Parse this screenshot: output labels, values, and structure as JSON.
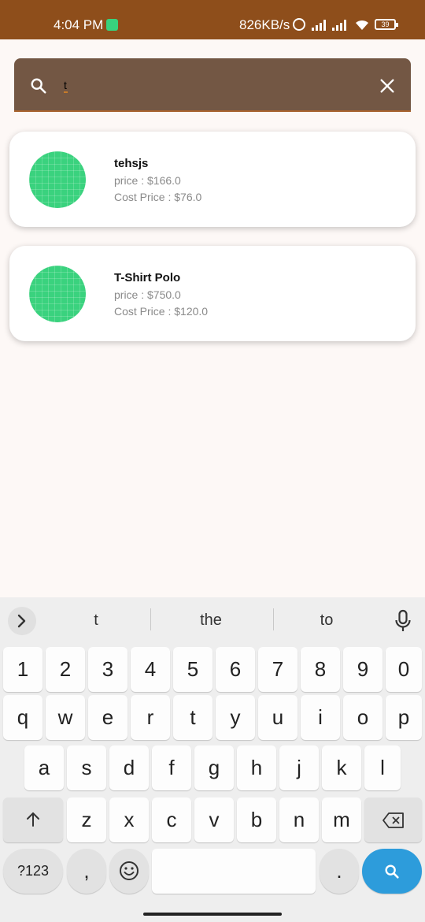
{
  "status_bar": {
    "time": "4:04 PM",
    "network_speed": "826KB/s",
    "battery": "39",
    "icons": [
      "app-notification-icon",
      "alarm-icon",
      "signal-icon",
      "signal-icon",
      "wifi-icon",
      "battery-icon"
    ]
  },
  "search": {
    "value": "t",
    "icon": "search-icon",
    "clear_icon": "close-icon"
  },
  "products": [
    {
      "name": "tehsjs",
      "price": "price : $166.0",
      "cost": "Cost Price : $76.0"
    },
    {
      "name": "T-Shirt Polo",
      "price": "price : $750.0",
      "cost": "Cost Price : $120.0"
    }
  ],
  "keyboard": {
    "suggestions": [
      "t",
      "the",
      "to"
    ],
    "row_numbers": [
      "1",
      "2",
      "3",
      "4",
      "5",
      "6",
      "7",
      "8",
      "9",
      "0"
    ],
    "row1": [
      "q",
      "w",
      "e",
      "r",
      "t",
      "y",
      "u",
      "i",
      "o",
      "p"
    ],
    "row2": [
      "a",
      "s",
      "d",
      "f",
      "g",
      "h",
      "j",
      "k",
      "l"
    ],
    "row3": [
      "z",
      "x",
      "c",
      "v",
      "b",
      "n",
      "m"
    ],
    "symbols_key": "?123",
    "comma_key": ",",
    "period_key": "."
  },
  "colors": {
    "status_bar": "#8e4e1b",
    "search_bar": "#735744",
    "avatar": "#3ad27e",
    "search_key": "#2d9cdb"
  }
}
